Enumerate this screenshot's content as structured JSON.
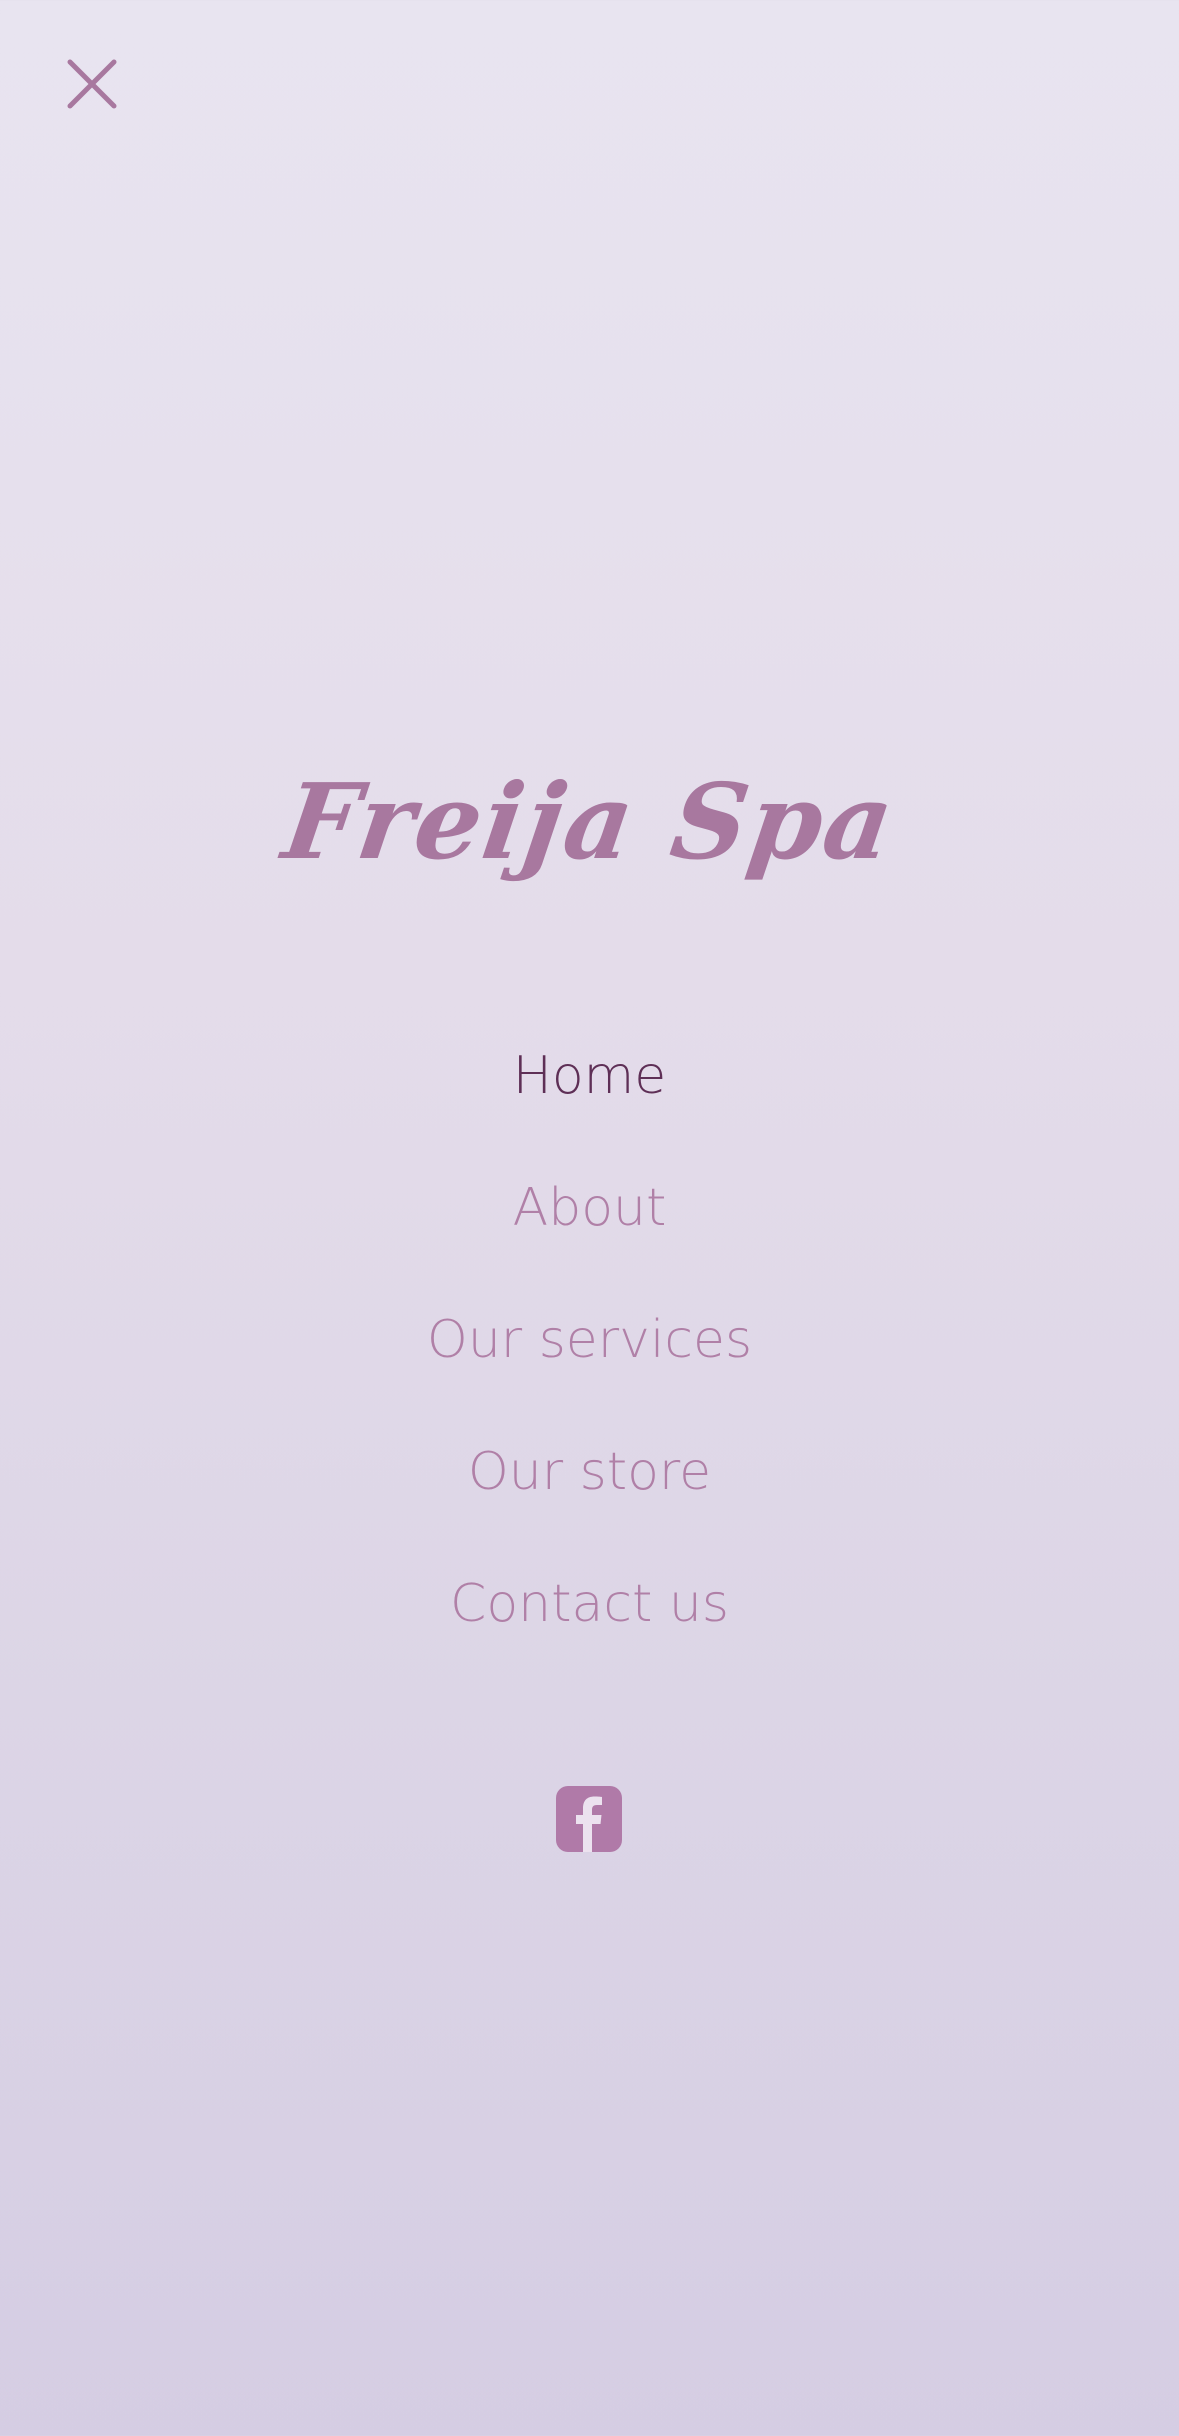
{
  "brand": {
    "name": "Freija Spa"
  },
  "menu": {
    "items": [
      {
        "label": "Home",
        "active": true
      },
      {
        "label": "About",
        "active": false
      },
      {
        "label": "Our services",
        "active": false
      },
      {
        "label": "Our store",
        "active": false
      },
      {
        "label": "Contact us",
        "active": false
      }
    ]
  },
  "icons": {
    "close": "close-icon",
    "social": "facebook-icon"
  },
  "colors": {
    "accent": "#b07aa8",
    "active": "#5e2f56",
    "background_top": "#e8e4f0",
    "background_bottom": "#d5cde3"
  }
}
